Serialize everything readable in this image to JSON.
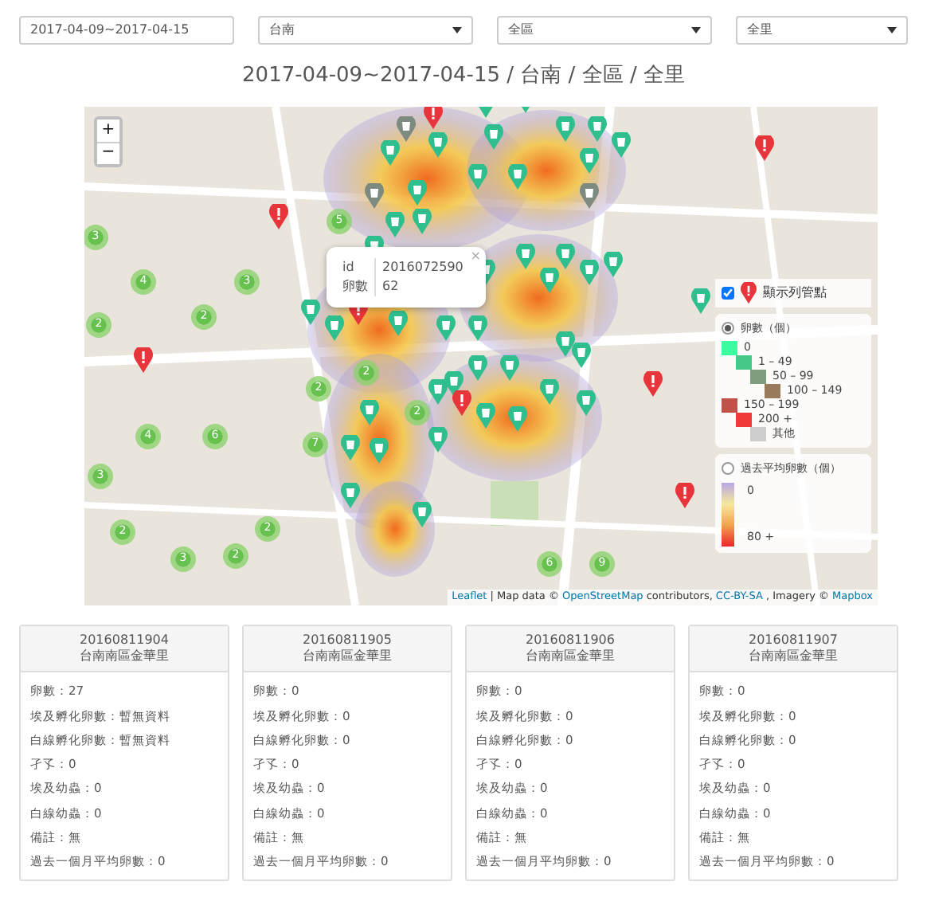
{
  "filters": [
    {
      "kind": "input",
      "value": "2017-04-09~2017-04-15"
    },
    {
      "kind": "select",
      "value": "台南"
    },
    {
      "kind": "select",
      "value": "全區"
    },
    {
      "kind": "select",
      "value": "全里"
    }
  ],
  "heading": "2017-04-09~2017-04-15 / 台南 / 全區 / 全里",
  "map": {
    "zoom_in": "+",
    "zoom_out": "−",
    "clusters": [
      "3",
      "4",
      "3",
      "2",
      "5",
      "2",
      "2",
      "2",
      "4",
      "6",
      "7",
      "3",
      "2",
      "3",
      "2",
      "2",
      "6",
      "9",
      "2"
    ],
    "popup": {
      "close": "×",
      "rows": [
        {
          "label": "id",
          "value": "2016072590"
        },
        {
          "label": "卵數",
          "value": "62"
        }
      ]
    },
    "legend": {
      "show_points": {
        "label": "顯示列管點",
        "checked": true
      },
      "sections": [
        {
          "kind": "steps",
          "title": "卵數（個）",
          "selected": true,
          "items": [
            {
              "label": "0",
              "color": "#3dfb9f"
            },
            {
              "label": "1 – 49",
              "color": "#44c98a"
            },
            {
              "label": "50 – 99",
              "color": "#7f9d7d"
            },
            {
              "label": "100 – 149",
              "color": "#9a7a5c"
            },
            {
              "label": "150 – 199",
              "color": "#c0524a"
            },
            {
              "label": "200 +",
              "color": "#f03a3a"
            },
            {
              "label": "其他",
              "color": "#cfcfcf"
            }
          ]
        },
        {
          "kind": "gradient",
          "title": "過去平均卵數（個）",
          "selected": false,
          "items": [
            {
              "label": "0"
            },
            {
              "label": "80 +"
            }
          ]
        }
      ]
    },
    "attribution": [
      {
        "text": "Leaflet",
        "kind": "link"
      },
      {
        "text": "| Map data ©",
        "kind": "text"
      },
      {
        "text": "OpenStreetMap",
        "kind": "link"
      },
      {
        "text": "contributors,",
        "kind": "text"
      },
      {
        "text": "CC-BY-SA",
        "kind": "link"
      },
      {
        "text": ", Imagery ©",
        "kind": "text"
      },
      {
        "text": "Mapbox",
        "kind": "link"
      }
    ]
  },
  "cards": [
    {
      "id": "20160811904",
      "name": "台南南區金華里",
      "lines": [
        "卵數：27",
        "埃及孵化卵數：暫無資料",
        "白線孵化卵數：暫無資料",
        "孑孓：0",
        "埃及幼蟲：0",
        "白線幼蟲：0",
        "備註：無",
        "過去一個月平均卵數：0"
      ]
    },
    {
      "id": "20160811905",
      "name": "台南南區金華里",
      "lines": [
        "卵數：0",
        "埃及孵化卵數：0",
        "白線孵化卵數：0",
        "孑孓：0",
        "埃及幼蟲：0",
        "白線幼蟲：0",
        "備註：無",
        "過去一個月平均卵數：0"
      ]
    },
    {
      "id": "20160811906",
      "name": "台南南區金華里",
      "lines": [
        "卵數：0",
        "埃及孵化卵數：0",
        "白線孵化卵數：0",
        "孑孓：0",
        "埃及幼蟲：0",
        "白線幼蟲：0",
        "備註：無",
        "過去一個月平均卵數：0"
      ]
    },
    {
      "id": "20160811907",
      "name": "台南南區金華里",
      "lines": [
        "卵數：0",
        "埃及孵化卵數：0",
        "白線孵化卵數：0",
        "孑孓：0",
        "埃及幼蟲：0",
        "白線幼蟲：0",
        "備註：無",
        "過去一個月平均卵數：0"
      ]
    }
  ]
}
